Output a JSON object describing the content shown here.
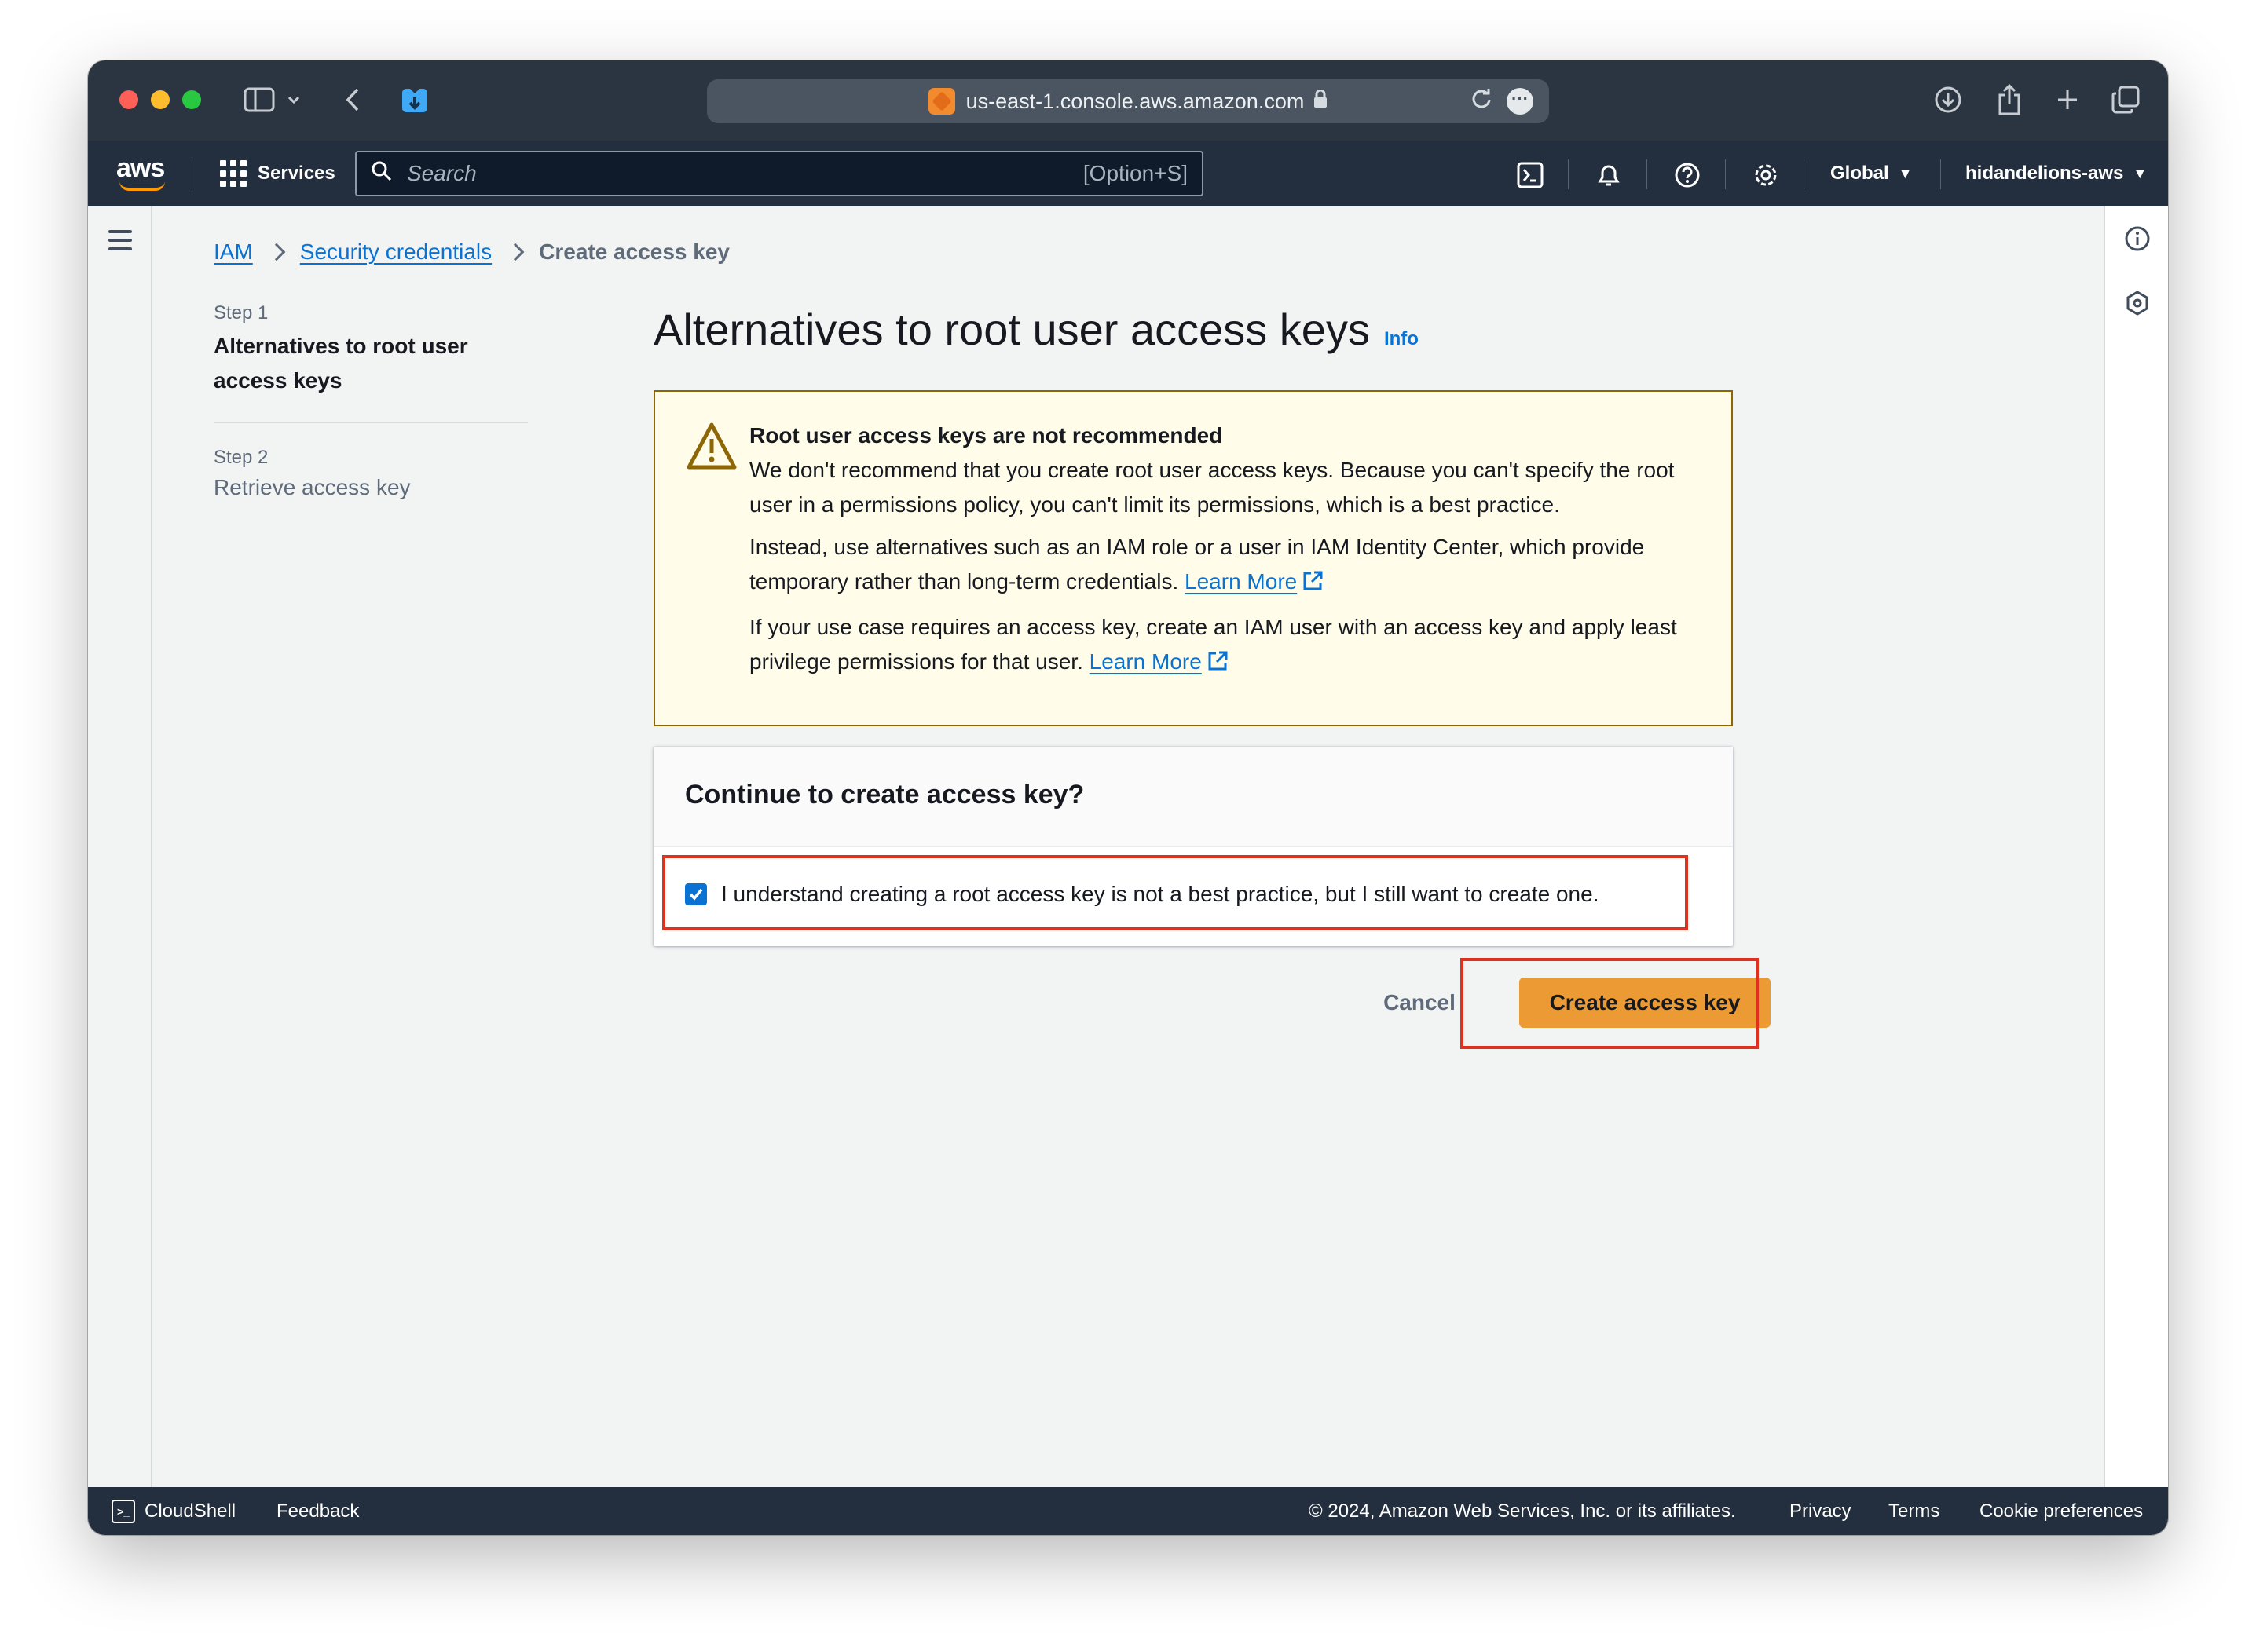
{
  "browser": {
    "url": "us-east-1.console.aws.amazon.com"
  },
  "nav": {
    "logo_text": "aws",
    "services_label": "Services",
    "search_placeholder": "Search",
    "search_shortcut": "[Option+S]",
    "region": "Global",
    "account": "hidandelions-aws"
  },
  "breadcrumb": {
    "items": [
      "IAM",
      "Security credentials"
    ],
    "current": "Create access key"
  },
  "steps": [
    {
      "number": "Step 1",
      "title": "Alternatives to root user access keys"
    },
    {
      "number": "Step 2",
      "title": "Retrieve access key"
    }
  ],
  "page": {
    "title": "Alternatives to root user access keys",
    "info_label": "Info"
  },
  "warning": {
    "title": "Root user access keys are not recommended",
    "p1": "We don't recommend that you create root user access keys. Because you can't specify the root user in a permissions policy, you can't limit its permissions, which is a best practice.",
    "p2": "Instead, use alternatives such as an IAM role or a user in IAM Identity Center, which provide temporary rather than long-term credentials.",
    "p3": "If your use case requires an access key, create an IAM user with an access key and apply least privilege permissions for that user.",
    "learn_more": "Learn More"
  },
  "confirm": {
    "heading": "Continue to create access key?",
    "checkbox_label": "I understand creating a root access key is not a best practice, but I still want to create one.",
    "checked": true
  },
  "actions": {
    "cancel": "Cancel",
    "create": "Create access key"
  },
  "footer": {
    "cloudshell": "CloudShell",
    "feedback": "Feedback",
    "copyright": "© 2024, Amazon Web Services, Inc. or its affiliates.",
    "privacy": "Privacy",
    "terms": "Terms",
    "cookies": "Cookie preferences"
  },
  "colors": {
    "nav_bg": "#232f3e",
    "link": "#0972d3",
    "primary_button": "#ec9b34",
    "warning_bg": "#fffce9",
    "annotation_red": "#e0301e"
  }
}
